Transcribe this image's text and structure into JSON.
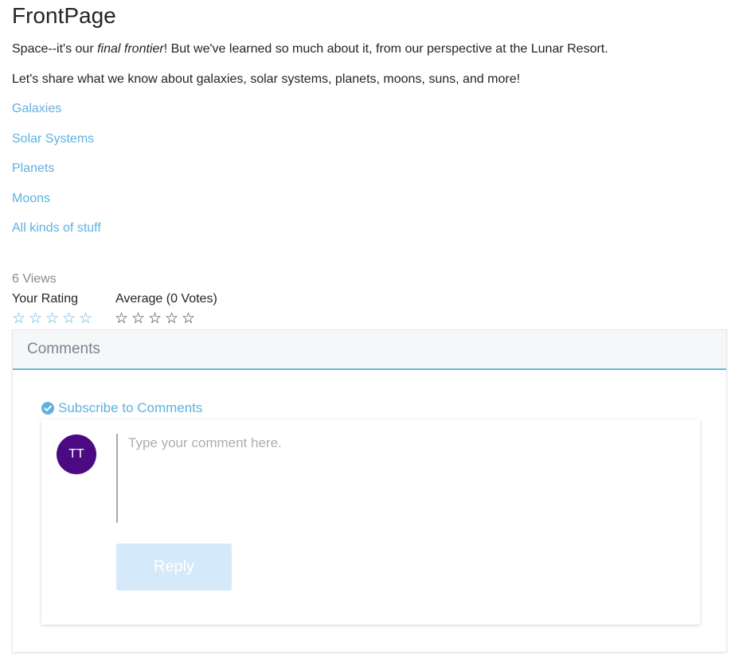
{
  "page": {
    "title": "FrontPage",
    "intro_prefix": "Space--it's our ",
    "intro_em": "final frontier",
    "intro_suffix": "! But we've learned so much about it, from our perspective at the Lunar Resort.",
    "intro_2": "Let's share what we know about galaxies, solar systems, planets, moons, suns, and more!"
  },
  "links": [
    {
      "label": "Galaxies"
    },
    {
      "label": "Solar Systems"
    },
    {
      "label": "Planets"
    },
    {
      "label": "Moons"
    },
    {
      "label": "All kinds of stuff"
    }
  ],
  "stats": {
    "views": "6 Views",
    "your_rating_label": "Your Rating",
    "your_rating_value": 0,
    "average_label": "Average (0 Votes)",
    "average_value": 0,
    "star_max": 5,
    "star_glyph": "☆"
  },
  "comments": {
    "title": "Comments",
    "subscribe_label": "Subscribe to Comments",
    "avatar_initials": "TT",
    "placeholder": "Type your comment here.",
    "reply_label": "Reply"
  },
  "colors": {
    "link": "#5fb1e0",
    "avatar": "#4b0a82",
    "header_border": "#6fb7d4",
    "reply_disabled": "#d4e9fa"
  }
}
